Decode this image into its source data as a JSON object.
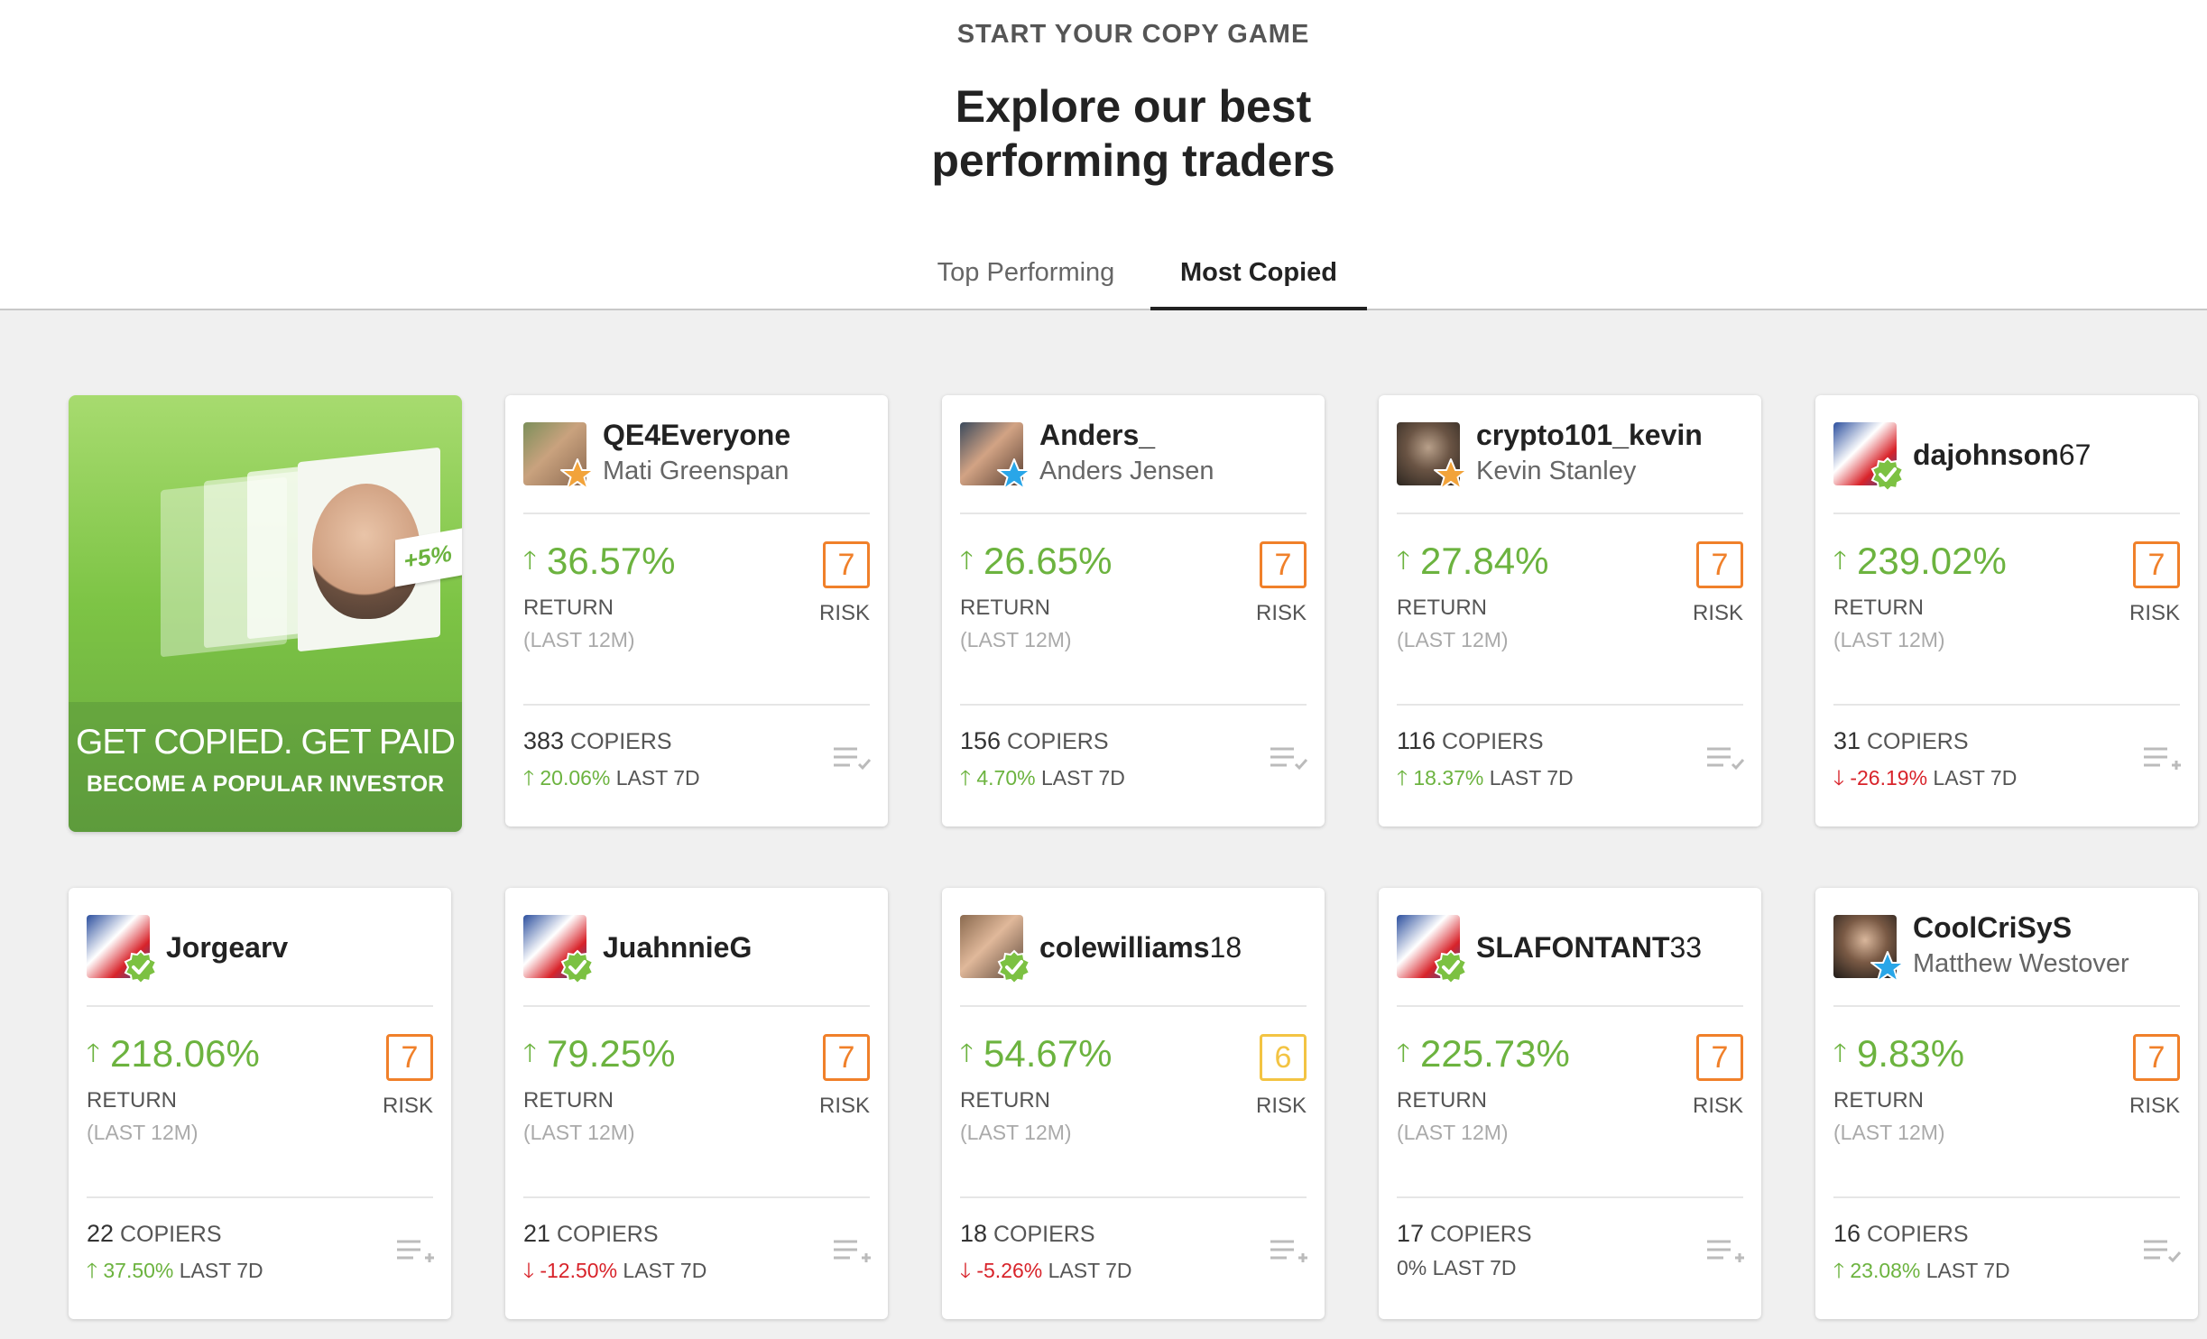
{
  "header": {
    "eyebrow": "START YOUR COPY GAME",
    "title_line1": "Explore our best",
    "title_line2": "performing traders"
  },
  "tabs": [
    {
      "label": "Top Performing",
      "active": false
    },
    {
      "label": "Most Copied",
      "active": true
    }
  ],
  "promo": {
    "badge_text": "+5%",
    "title": "GET COPIED. GET PAID",
    "subtitle": "BECOME A POPULAR INVESTOR"
  },
  "labels": {
    "return": "RETURN",
    "period": "(LAST 12M)",
    "risk": "RISK",
    "copiers": "COPIERS",
    "last7d": "LAST 7D"
  },
  "colors": {
    "positive": "#6cb33f",
    "negative": "#d8232a",
    "risk7": "#f0802a",
    "risk6": "#f3c443",
    "star_orange": "#f2a33a",
    "star_blue": "#29a6e8",
    "check_green": "#7cc142"
  },
  "traders": [
    {
      "username": "QE4Everyone",
      "username_num": "",
      "full_name": "Mati Greenspan",
      "badge_icon": "orange-star-icon",
      "return": "36.57%",
      "risk": "7",
      "copiers": "383",
      "change_7d": "20.06%",
      "change_dir": "up",
      "action_icon": "list-check-icon"
    },
    {
      "username": "Anders_",
      "username_num": "",
      "full_name": "Anders Jensen",
      "badge_icon": "blue-star-icon",
      "return": "26.65%",
      "risk": "7",
      "copiers": "156",
      "change_7d": "4.70%",
      "change_dir": "up",
      "action_icon": "list-check-icon"
    },
    {
      "username": "crypto101_kevin",
      "username_num": "",
      "full_name": "Kevin Stanley",
      "badge_icon": "orange-star-icon",
      "return": "27.84%",
      "risk": "7",
      "copiers": "116",
      "change_7d": "18.37%",
      "change_dir": "up",
      "action_icon": "list-check-icon"
    },
    {
      "username": "dajohnson",
      "username_num": "67",
      "full_name": "",
      "badge_icon": "green-check-icon",
      "return": "239.02%",
      "risk": "7",
      "copiers": "31",
      "change_7d": "-26.19%",
      "change_dir": "down",
      "action_icon": "list-add-icon"
    },
    {
      "username": "Jorgearv",
      "username_num": "",
      "full_name": "",
      "badge_icon": "green-check-icon",
      "return": "218.06%",
      "risk": "7",
      "copiers": "22",
      "change_7d": "37.50%",
      "change_dir": "up",
      "action_icon": "list-add-icon"
    },
    {
      "username": "JuahnnieG",
      "username_num": "",
      "full_name": "",
      "badge_icon": "green-check-icon",
      "return": "79.25%",
      "risk": "7",
      "copiers": "21",
      "change_7d": "-12.50%",
      "change_dir": "down",
      "action_icon": "list-add-icon"
    },
    {
      "username": "colewilliams",
      "username_num": "18",
      "full_name": "",
      "badge_icon": "green-check-icon",
      "return": "54.67%",
      "risk": "6",
      "copiers": "18",
      "change_7d": "-5.26%",
      "change_dir": "down",
      "action_icon": "list-add-icon"
    },
    {
      "username": "SLAFONTANT",
      "username_num": "33",
      "full_name": "",
      "badge_icon": "green-check-icon",
      "return": "225.73%",
      "risk": "7",
      "copiers": "17",
      "change_7d": "0%",
      "change_dir": "flat",
      "action_icon": "list-add-icon"
    },
    {
      "username": "CoolCriSyS",
      "username_num": "",
      "full_name": "Matthew Westover",
      "badge_icon": "blue-star-icon",
      "return": "9.83%",
      "risk": "7",
      "copiers": "16",
      "change_7d": "23.08%",
      "change_dir": "up",
      "action_icon": "list-check-icon"
    }
  ]
}
